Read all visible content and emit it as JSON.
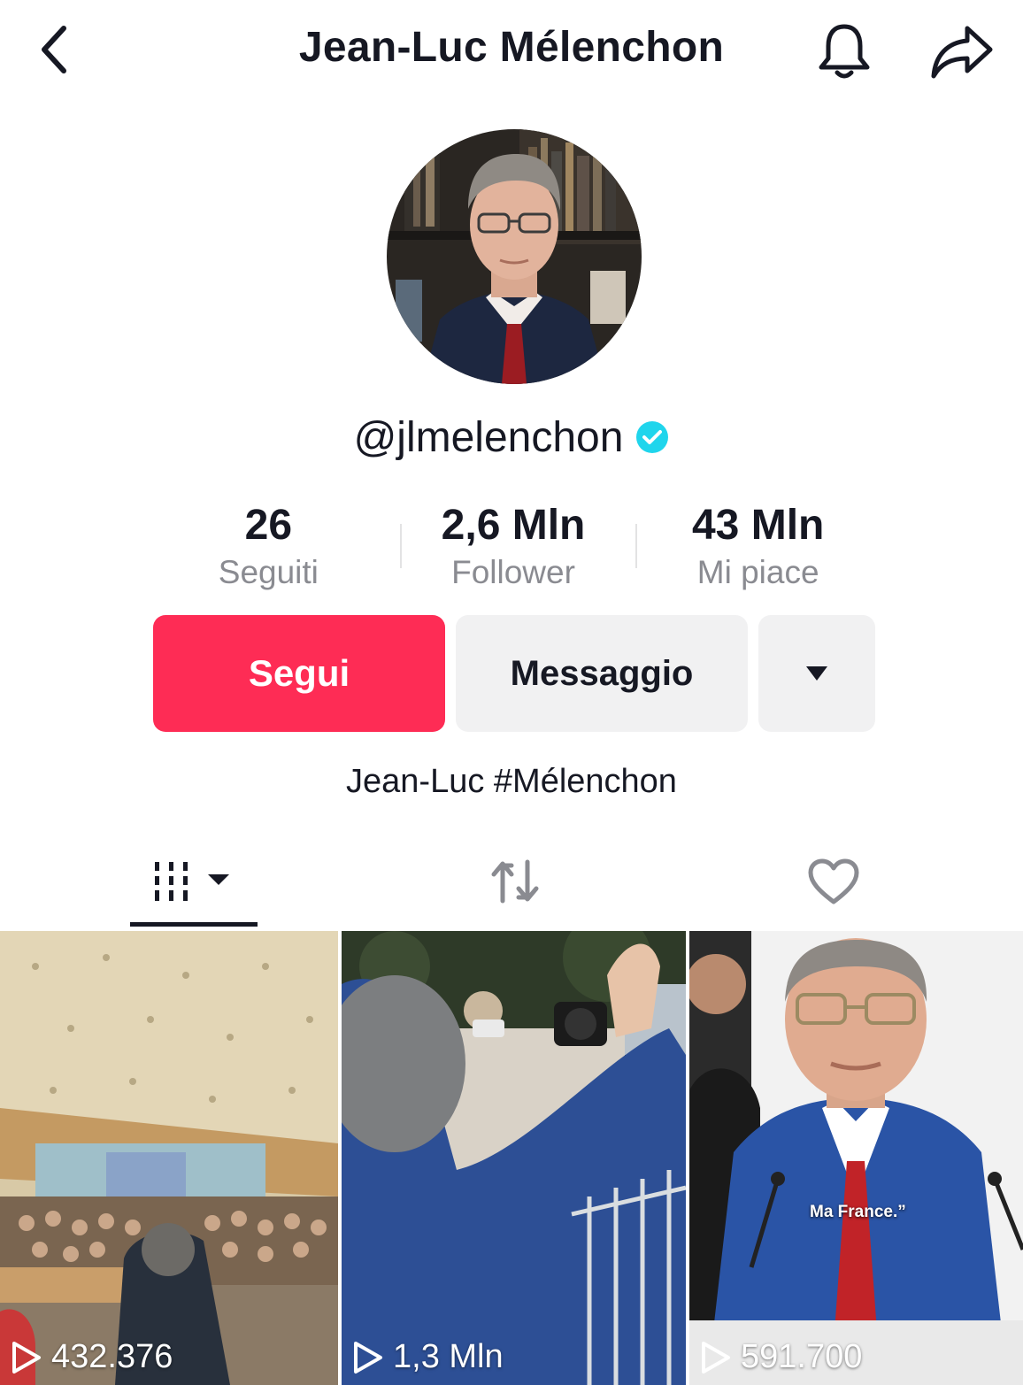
{
  "header": {
    "title": "Jean-Luc Mélenchon",
    "back_icon": "chevron-left-icon",
    "bell_icon": "bell-icon",
    "share_icon": "share-icon"
  },
  "profile": {
    "username": "@jlmelenchon",
    "verified": true,
    "bio": "Jean-Luc #Mélenchon"
  },
  "stats": [
    {
      "value": "26",
      "label": "Seguiti"
    },
    {
      "value": "2,6 Mln",
      "label": "Follower"
    },
    {
      "value": "43 Mln",
      "label": "Mi piace"
    }
  ],
  "buttons": {
    "follow": "Segui",
    "message": "Messaggio",
    "more_icon": "caret-down-icon"
  },
  "tabs": [
    {
      "icon": "videos-grid-icon",
      "active": true
    },
    {
      "icon": "repost-icon",
      "active": false
    },
    {
      "icon": "heart-icon",
      "active": false
    }
  ],
  "videos": [
    {
      "views": "432.376"
    },
    {
      "views": "1,3 Mln"
    },
    {
      "views": "591.700",
      "caption": "Ma France.”"
    }
  ],
  "colors": {
    "accent": "#fe2c55",
    "verified": "#20d5ec",
    "text": "#161823",
    "muted": "#8a8b91",
    "button_bg": "#f1f1f2"
  }
}
